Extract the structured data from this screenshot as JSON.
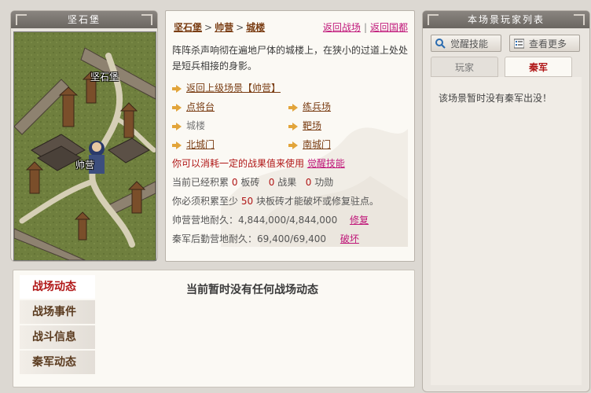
{
  "map_panel": {
    "title": "坚石堡",
    "label_fortress": "坚石堡",
    "label_camp": "帅营"
  },
  "info": {
    "breadcrumb": [
      "坚石堡",
      "帅营",
      "城楼"
    ],
    "breadcrumb_sep": ">",
    "link_back_battle": "返回战场",
    "link_back_capital": "返回国都",
    "link_divider": "|",
    "description": "阵阵杀声响彻在遍地尸体的城楼上，在狭小的过道上处处是短兵相接的身影。",
    "nav_up": "返回上级场景【帅营】",
    "nav": {
      "dianjiangtai": "点将台",
      "lianbingchang": "练兵场",
      "chenglou": "城楼",
      "bachang": "靶场",
      "beichengmen": "北城门",
      "nanchengmen": "南城门"
    },
    "awaken_prefix": "你可以消耗一定的战果值来使用",
    "awaken_link": "觉醒技能",
    "accum_prefix": "当前已经积累",
    "accum_bricks": "0",
    "accum_bricks_unit": "板砖",
    "accum_merit": "0",
    "accum_merit_unit": "战果",
    "accum_exploit": "0",
    "accum_exploit_unit": "功勋",
    "need_prefix": "你必须积累至少",
    "need_value": "50",
    "need_suffix": "块板砖才能破坏或修复驻点。",
    "camp_dur_label": "帅营营地耐久：",
    "camp_dur_value": "4,844,000/4,844,000",
    "camp_dur_action": "修复",
    "qin_dur_label": "秦军后勤营地耐久：",
    "qin_dur_value": "69,400/69,400",
    "qin_dur_action": "破坏"
  },
  "right_panel": {
    "title": "本场景玩家列表",
    "btn_awaken": "觉醒技能",
    "btn_more": "查看更多",
    "tab_players": "玩家",
    "tab_qin": "秦军",
    "empty_msg": "该场景暂时没有秦军出没！"
  },
  "battle": {
    "tabs": [
      "战场动态",
      "战场事件",
      "战斗信息",
      "秦军动态"
    ],
    "active_tab": 0,
    "message": "当前暂时没有任何战场动态"
  },
  "colors": {
    "accent_red": "#b01616",
    "link_brown": "#7a3d13",
    "link_pink": "#c0187a",
    "arrow_gold": "#e2a43a"
  }
}
